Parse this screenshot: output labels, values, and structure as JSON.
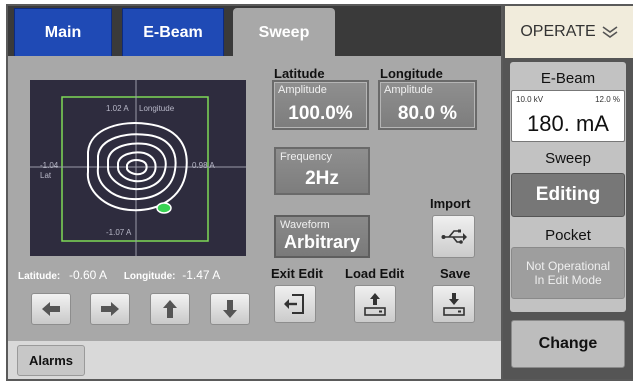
{
  "tabs": [
    {
      "label": "Main",
      "state": "inactive"
    },
    {
      "label": "E-Beam",
      "state": "inactive"
    },
    {
      "label": "Sweep",
      "state": "active"
    }
  ],
  "plot": {
    "top_label": "1.02 A",
    "longitude_axis_label": "Longitude",
    "left_label": "-1.04",
    "right_label": "0.98 A",
    "latitude_axis_label": "Lat",
    "bottom_label": "-1.07 A"
  },
  "readouts": {
    "latitude_label": "Latitude:",
    "latitude_value": "-0.60 A",
    "longitude_label": "Longitude:",
    "longitude_value": "-1.47 A"
  },
  "nudge_buttons": [
    "arrow-left-icon",
    "arrow-right-icon",
    "arrow-up-icon",
    "arrow-down-icon"
  ],
  "latitude": {
    "header": "Latitude",
    "amplitude_label": "Amplitude",
    "amplitude_value": "100.0%"
  },
  "longitude": {
    "header": "Longitude",
    "amplitude_label": "Amplitude",
    "amplitude_value": "80.0 %"
  },
  "frequency": {
    "label": "Frequency",
    "value": "2Hz"
  },
  "waveform": {
    "label": "Waveform",
    "value": "Arbitrary"
  },
  "actions": {
    "import_label": "Import",
    "exit_edit_label": "Exit Edit",
    "load_edit_label": "Load Edit",
    "save_label": "Save"
  },
  "bottom": {
    "alarms_label": "Alarms"
  },
  "sidebar": {
    "operate_label": "OPERATE",
    "ebeam_title": "E-Beam",
    "ebeam_kv": "10.0 kV",
    "ebeam_pct": "12.0 %",
    "ebeam_current": "180. mA",
    "sweep_title": "Sweep",
    "sweep_status": "Editing",
    "pocket_title": "Pocket",
    "pocket_status_line1": "Not Operational",
    "pocket_status_line2": "In Edit Mode",
    "change_label": "Change"
  },
  "colors": {
    "tab_blue": "#1f4ab5",
    "plot_bg": "#2e2c3e",
    "plot_frame": "#7ed957",
    "marker": "#39d353"
  }
}
